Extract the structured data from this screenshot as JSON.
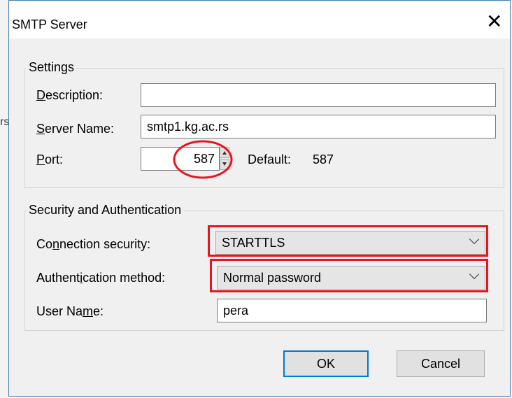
{
  "dialog": {
    "title": "SMTP Server",
    "close_glyph": "✕"
  },
  "settings": {
    "legend": "Settings",
    "description": {
      "label_pre": "",
      "label_u": "D",
      "label_post": "escription:",
      "value": ""
    },
    "server_name": {
      "label_pre": "",
      "label_u": "S",
      "label_post": "erver Name:",
      "value": "smtp1.kg.ac.rs"
    },
    "port": {
      "label_pre": "",
      "label_u": "P",
      "label_post": "ort:",
      "value": "587",
      "default_label": "Default:",
      "default_value": "587"
    }
  },
  "security": {
    "legend": "Security and Authentication",
    "connection_security": {
      "label_pre": "Co",
      "label_u": "n",
      "label_post": "nection security:",
      "value": "STARTTLS"
    },
    "auth_method": {
      "label_pre": "Authent",
      "label_u": "i",
      "label_post": "cation method:",
      "value": "Normal password"
    },
    "user_name": {
      "label_pre": "User Na",
      "label_u": "m",
      "label_post": "e:",
      "value": "pera"
    }
  },
  "buttons": {
    "ok": "OK",
    "cancel": "Cancel"
  },
  "background": {
    "glyph": "rs"
  },
  "colors": {
    "annotation": "#e8141e",
    "focus_accent": "#0078d7",
    "dialog_border": "#3c7fb1"
  }
}
